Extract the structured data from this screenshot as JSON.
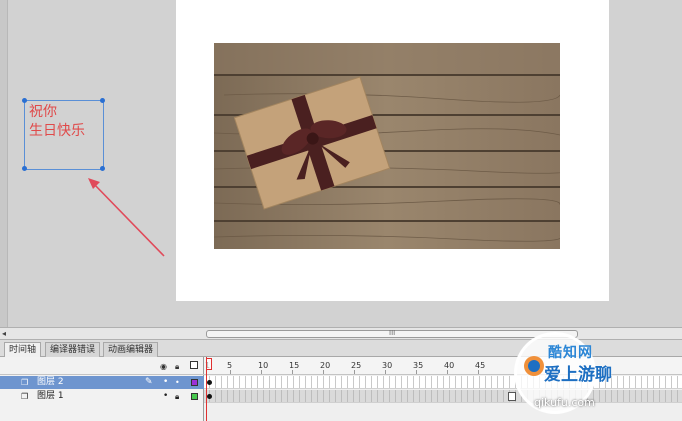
{
  "stage": {
    "textbox_text": "祝你\n生日快乐"
  },
  "timeline": {
    "tabs": [
      {
        "label": "时间轴"
      },
      {
        "label": "编译器错误"
      },
      {
        "label": "动画编辑器"
      }
    ],
    "ruler_labels": [
      "1",
      "5",
      "10",
      "15",
      "20",
      "25",
      "30",
      "35",
      "40",
      "45"
    ],
    "layers": [
      {
        "name": "图层 2",
        "selected": true,
        "swatch_color": "#9b2fd8"
      },
      {
        "name": "图层 1",
        "selected": false,
        "swatch_color": "#46c84e"
      }
    ]
  },
  "scrollbar": {
    "grip": "III"
  },
  "watermark": {
    "top_text": "酷知网",
    "mid_text": "爱上游聊",
    "url": "qikufu.com"
  },
  "colors": {
    "accent_selection": "#6e95cf",
    "text_red": "#e04a4a",
    "playhead": "#e03030"
  }
}
